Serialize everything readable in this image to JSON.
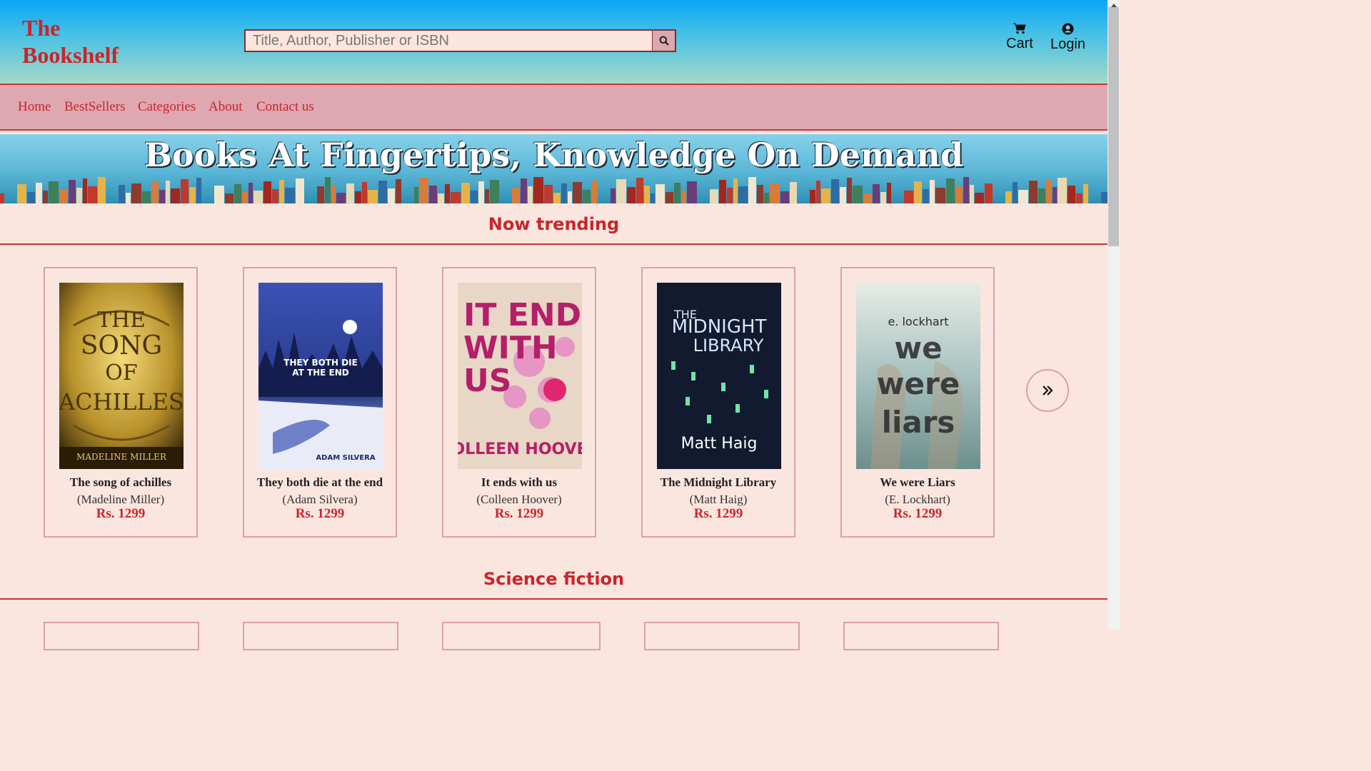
{
  "header": {
    "logo_line1": "The",
    "logo_line2": "Bookshelf",
    "search_placeholder": "Title, Author, Publisher or ISBN",
    "cart_label": "Cart",
    "login_label": "Login"
  },
  "nav": {
    "items": [
      {
        "label": "Home"
      },
      {
        "label": "BestSellers"
      },
      {
        "label": "Categories"
      },
      {
        "label": "About"
      },
      {
        "label": "Contact us"
      }
    ]
  },
  "banner": {
    "title": "Books At Fingertips, Knowledge On Demand"
  },
  "sections": {
    "trending_title": "Now trending",
    "scifi_title": "Science fiction"
  },
  "books": [
    {
      "title": "The song of achilles",
      "author": "(Madeline Miller)",
      "price": "Rs. 1299",
      "cover_lines": [
        "THE",
        "SONG",
        "OF",
        "ACHILLES"
      ],
      "cover_author": "MADELINE MILLER",
      "cover_color": "#b8902a"
    },
    {
      "title": "They both die at the end",
      "author": "(Adam Silvera)",
      "price": "Rs. 1299",
      "cover_lines": [
        "THEY BOTH DIE",
        "AT THE END"
      ],
      "cover_author": "ADAM SILVERA",
      "cover_color": "#2d3f8f"
    },
    {
      "title": "It ends with us",
      "author": "(Colleen Hoover)",
      "price": "Rs. 1299",
      "cover_lines": [
        "IT ENDS",
        "WITH",
        "US"
      ],
      "cover_author": "COLLEEN HOOVER",
      "cover_color": "#e8d7c6"
    },
    {
      "title": "The Midnight Library",
      "author": "(Matt Haig)",
      "price": "Rs. 1299",
      "cover_lines": [
        "THE",
        "MIDNIGHT",
        "LIBRARY"
      ],
      "cover_author": "Matt Haig",
      "cover_color": "#111a2e"
    },
    {
      "title": "We were Liars",
      "author": "(E. Lockhart)",
      "price": "Rs. 1299",
      "cover_lines": [
        "we",
        "were",
        "liars"
      ],
      "cover_author": "e. lockhart",
      "cover_color": "#9fbcbe"
    }
  ],
  "colors": {
    "accent": "#c8262b",
    "nav_bg": "#dea7b1",
    "page_bg": "#fbe5df"
  }
}
